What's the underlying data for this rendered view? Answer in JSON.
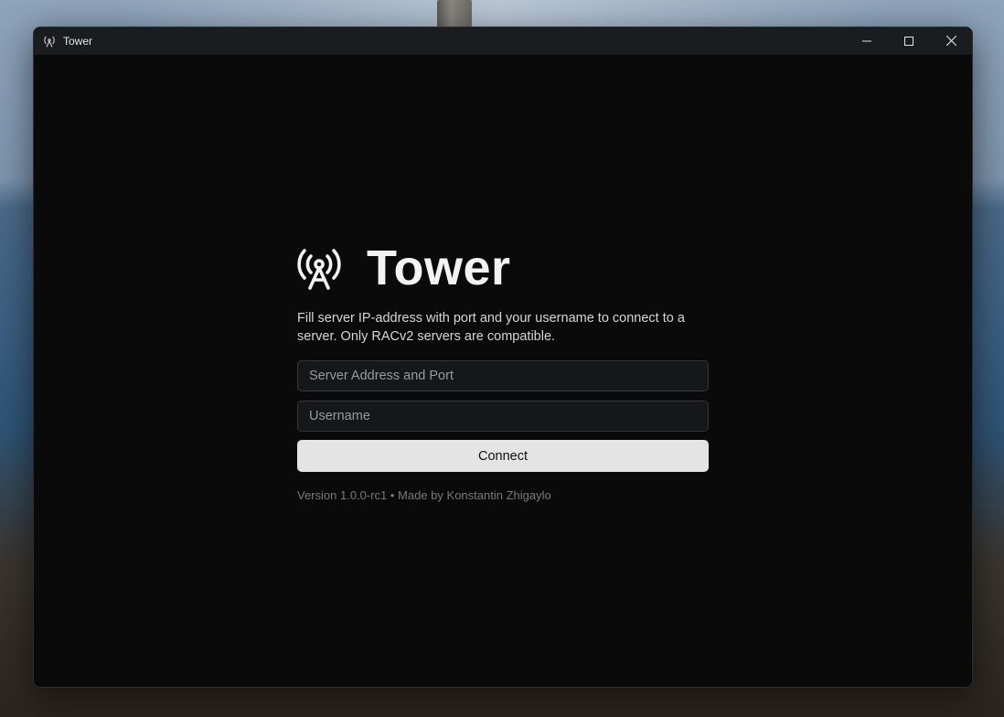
{
  "window": {
    "title": "Tower"
  },
  "brand": {
    "name": "Tower",
    "icon": "radio-tower-icon"
  },
  "description": "Fill server IP-address with port and your username to connect to a server. Only RACv2 servers are compatible.",
  "form": {
    "server_placeholder": "Server Address and Port",
    "server_value": "",
    "username_placeholder": "Username",
    "username_value": "",
    "connect_label": "Connect"
  },
  "footer": "Version 1.0.0-rc1 • Made by Konstantin Zhigaylo",
  "colors": {
    "window_bg": "#0a0a0b",
    "titlebar_bg": "#1a1c1f",
    "button_bg": "#e4e4e4"
  }
}
